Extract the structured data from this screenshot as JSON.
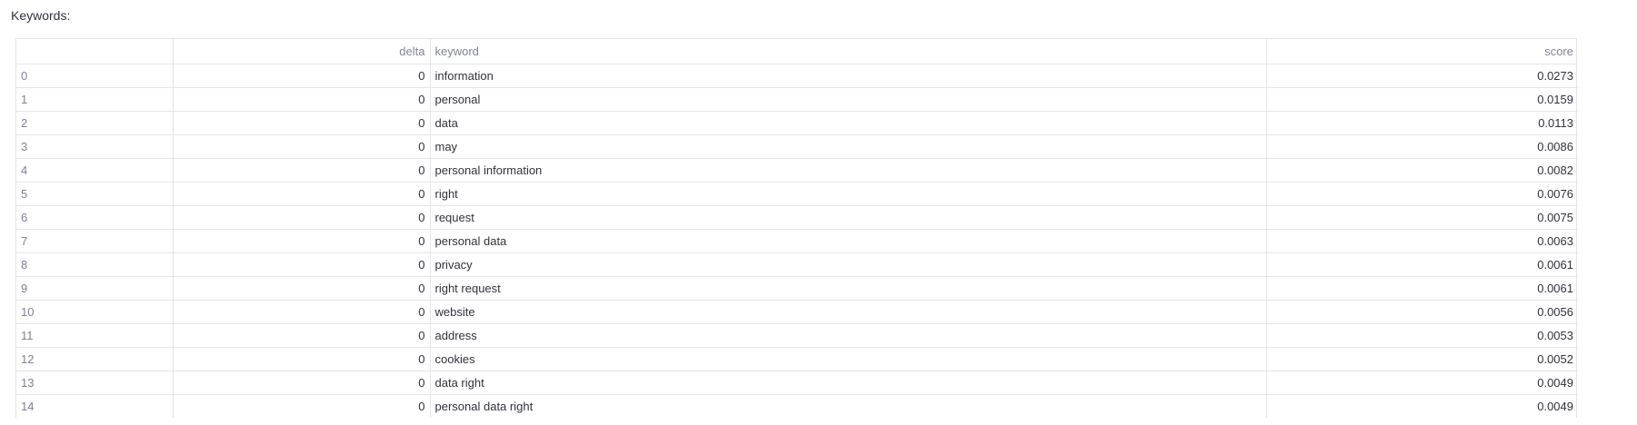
{
  "label": "Keywords:",
  "table": {
    "columns": [
      "",
      "delta",
      "keyword",
      "score"
    ],
    "rows": [
      {
        "index": "0",
        "delta": "0",
        "keyword": "information",
        "score": "0.0273"
      },
      {
        "index": "1",
        "delta": "0",
        "keyword": "personal",
        "score": "0.0159"
      },
      {
        "index": "2",
        "delta": "0",
        "keyword": "data",
        "score": "0.0113"
      },
      {
        "index": "3",
        "delta": "0",
        "keyword": "may",
        "score": "0.0086"
      },
      {
        "index": "4",
        "delta": "0",
        "keyword": "personal information",
        "score": "0.0082"
      },
      {
        "index": "5",
        "delta": "0",
        "keyword": "right",
        "score": "0.0076"
      },
      {
        "index": "6",
        "delta": "0",
        "keyword": "request",
        "score": "0.0075"
      },
      {
        "index": "7",
        "delta": "0",
        "keyword": "personal data",
        "score": "0.0063"
      },
      {
        "index": "8",
        "delta": "0",
        "keyword": "privacy",
        "score": "0.0061"
      },
      {
        "index": "9",
        "delta": "0",
        "keyword": "right request",
        "score": "0.0061"
      },
      {
        "index": "10",
        "delta": "0",
        "keyword": "website",
        "score": "0.0056"
      },
      {
        "index": "11",
        "delta": "0",
        "keyword": "address",
        "score": "0.0053"
      },
      {
        "index": "12",
        "delta": "0",
        "keyword": "cookies",
        "score": "0.0052"
      },
      {
        "index": "13",
        "delta": "0",
        "keyword": "data right",
        "score": "0.0049"
      },
      {
        "index": "14",
        "delta": "0",
        "keyword": "personal data right",
        "score": "0.0049"
      }
    ]
  }
}
